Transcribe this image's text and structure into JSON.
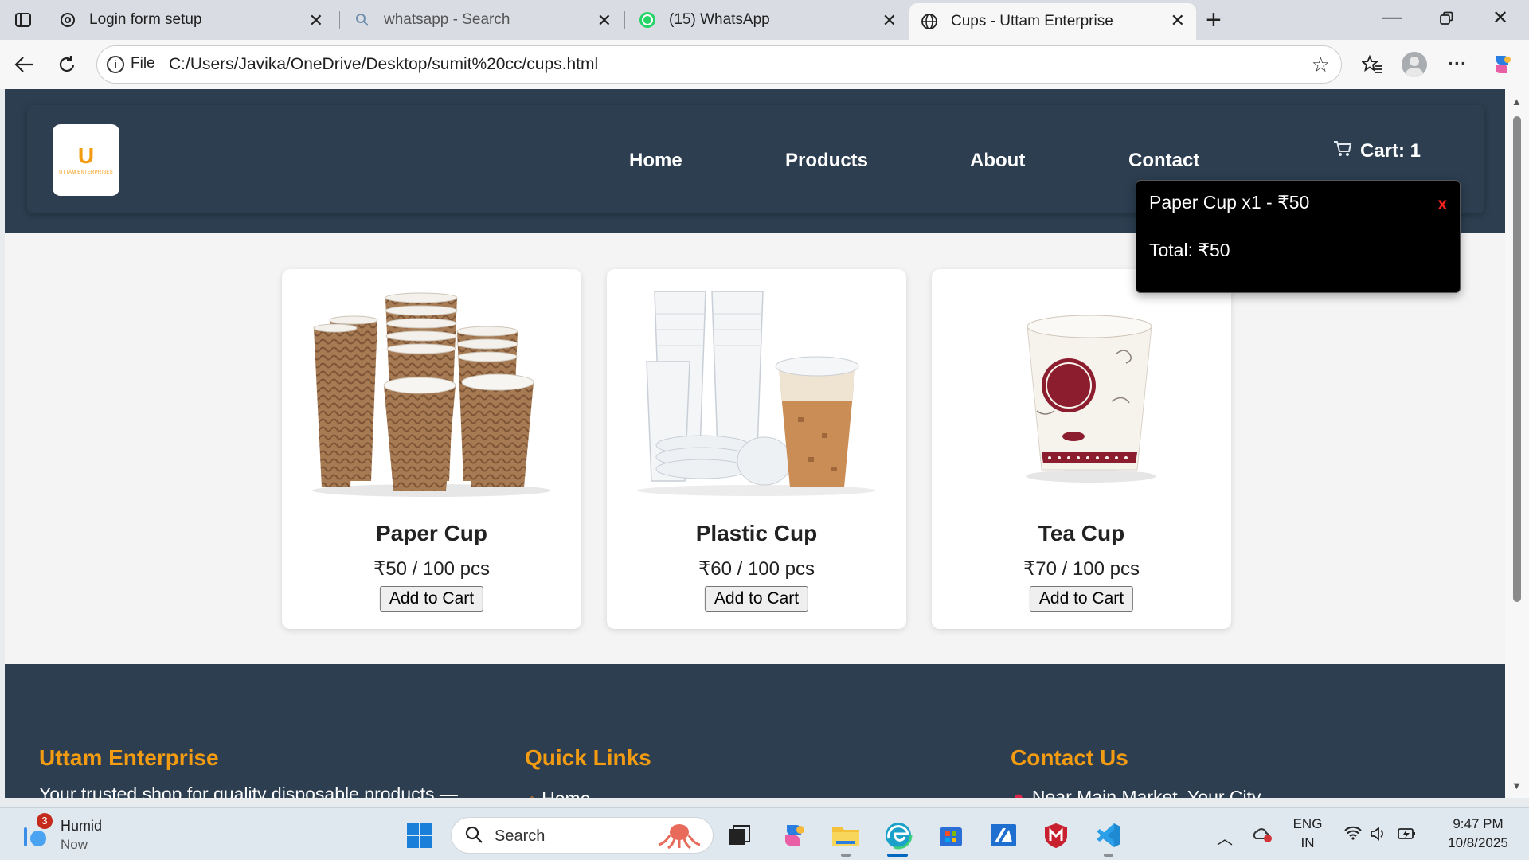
{
  "browser": {
    "tabs": [
      {
        "title": "Login form setup",
        "icon": "openai-icon"
      },
      {
        "title": "whatsapp - Search",
        "icon": "search-icon"
      },
      {
        "title": "(15) WhatsApp",
        "icon": "whatsapp-icon"
      },
      {
        "title": "Cups - Uttam Enterprise",
        "icon": "globe-icon",
        "active": true
      }
    ],
    "address": {
      "scheme_label": "File",
      "url": "C:/Users/Javika/OneDrive/Desktop/sumit%20cc/cups.html"
    }
  },
  "site": {
    "logo_mark": "U",
    "logo_text": "UTTAM ENTERPRISES",
    "nav": [
      "Home",
      "Products",
      "About",
      "Contact"
    ],
    "cart_label": "Cart: 1",
    "cart_popup": {
      "item": "Paper Cup x1 - ₹50",
      "close": "x",
      "total": "Total: ₹50"
    },
    "products": [
      {
        "name": "Paper Cup",
        "price": "₹50 / 100 pcs",
        "button": "Add to Cart"
      },
      {
        "name": "Plastic Cup",
        "price": "₹60 / 100 pcs",
        "button": "Add to Cart"
      },
      {
        "name": "Tea Cup",
        "price": "₹70 / 100 pcs",
        "button": "Add to Cart"
      }
    ],
    "footer": {
      "about_title": "Uttam Enterprise",
      "about_text": "Your trusted shop for quality disposable products —",
      "links_title": "Quick Links",
      "links_first": "Home",
      "contact_title": "Contact Us",
      "contact_address": "Near Main Market, Your City"
    }
  },
  "taskbar": {
    "weather_title": "Humid",
    "weather_sub": "Now",
    "weather_badge": "3",
    "search_label": "Search",
    "lang_top": "ENG",
    "lang_bottom": "IN",
    "time": "9:47 PM",
    "date": "10/8/2025"
  },
  "colors": {
    "header_bg": "#2c3e50",
    "accent": "#f39c12",
    "popup_bg": "#000000",
    "close_red": "#ff2020"
  }
}
